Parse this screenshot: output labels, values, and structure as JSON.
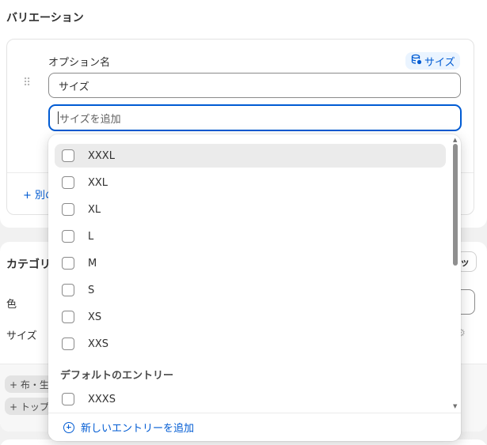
{
  "variation": {
    "title": "バリエーション",
    "option_name_label": "オプション名",
    "badge_label": "サイズ",
    "option_name_value": "サイズ",
    "value_placeholder": "サイズを追加",
    "add_other_label": "+ 別の"
  },
  "category": {
    "title": "カテゴリ",
    "right_button_text": "ッ",
    "rows": [
      "色",
      "サイズ"
    ],
    "chips": [
      "+ 布・生",
      "+ トップ"
    ]
  },
  "dropdown": {
    "options": [
      "XXXL",
      "XXL",
      "XL",
      "L",
      "M",
      "S",
      "XS",
      "XXS"
    ],
    "highlighted_index": 0,
    "group_heading": "デフォルトのエントリー",
    "group_options": [
      "XXXS"
    ],
    "add_entry_label": "新しいエントリーを追加"
  },
  "colors": {
    "accent": "#005bd3",
    "highlight": "#ebebeb",
    "badge_bg": "#eaf4ff"
  }
}
